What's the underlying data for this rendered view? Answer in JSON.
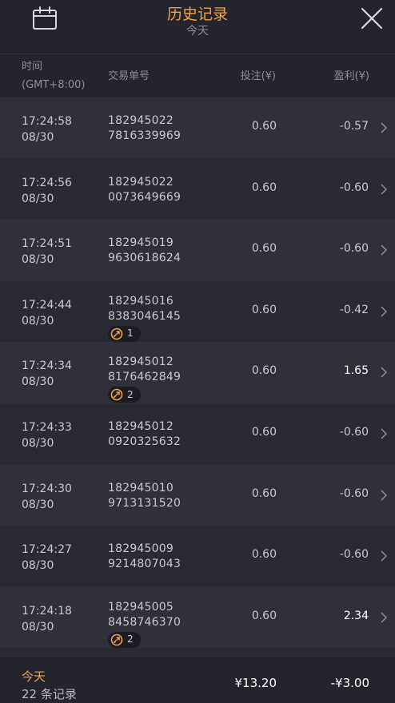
{
  "header": {
    "title": "历史记录",
    "subtitle": "今天",
    "calendar_icon": "calendar-icon",
    "close_icon": "close-icon"
  },
  "columns": {
    "time_line1": "时间",
    "time_line2": "(GMT+8:00)",
    "id": "交易单号",
    "bet": "投注(¥)",
    "profit": "盈利(¥)"
  },
  "rows": [
    {
      "time": "17:24:58",
      "date": "08/30",
      "id1": "182945022",
      "id2": "7816339969",
      "badge": "",
      "bet": "0.60",
      "profit": "-0.57",
      "win": false
    },
    {
      "time": "17:24:56",
      "date": "08/30",
      "id1": "182945022",
      "id2": "0073649669",
      "badge": "",
      "bet": "0.60",
      "profit": "-0.60",
      "win": false
    },
    {
      "time": "17:24:51",
      "date": "08/30",
      "id1": "182945019",
      "id2": "9630618624",
      "badge": "",
      "bet": "0.60",
      "profit": "-0.60",
      "win": false
    },
    {
      "time": "17:24:44",
      "date": "08/30",
      "id1": "182945016",
      "id2": "8383046145",
      "badge": "1",
      "bet": "0.60",
      "profit": "-0.42",
      "win": false
    },
    {
      "time": "17:24:34",
      "date": "08/30",
      "id1": "182945012",
      "id2": "8176462849",
      "badge": "2",
      "bet": "0.60",
      "profit": "1.65",
      "win": true
    },
    {
      "time": "17:24:33",
      "date": "08/30",
      "id1": "182945012",
      "id2": "0920325632",
      "badge": "",
      "bet": "0.60",
      "profit": "-0.60",
      "win": false
    },
    {
      "time": "17:24:30",
      "date": "08/30",
      "id1": "182945010",
      "id2": "9713131520",
      "badge": "",
      "bet": "0.60",
      "profit": "-0.60",
      "win": false
    },
    {
      "time": "17:24:27",
      "date": "08/30",
      "id1": "182945009",
      "id2": "9214807043",
      "badge": "",
      "bet": "0.60",
      "profit": "-0.60",
      "win": false
    },
    {
      "time": "17:24:18",
      "date": "08/30",
      "id1": "182945005",
      "id2": "8458746370",
      "badge": "2",
      "bet": "0.60",
      "profit": "2.34",
      "win": true
    }
  ],
  "footer": {
    "day": "今天",
    "count": "22 条记录",
    "total_bet": "¥13.20",
    "total_profit": "-¥3.00"
  },
  "colors": {
    "accent": "#f0a24a",
    "background": "#2a2a33",
    "row_alt": "#30303a"
  }
}
